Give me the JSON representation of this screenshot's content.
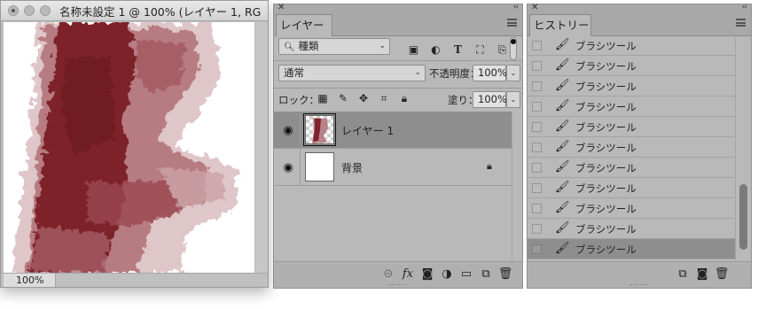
{
  "document": {
    "title": "名称未設定 1 @ 100% (レイヤー 1, RG...",
    "zoom": "100%"
  },
  "layers_panel": {
    "tab": "レイヤー",
    "filter_kind": "種類",
    "blend_mode": "通常",
    "opacity_label": "不透明度：",
    "opacity_value": "100%",
    "lock_label": "ロック：",
    "fill_label": "塗り：",
    "fill_value": "100%",
    "layers": [
      {
        "name": "レイヤー 1",
        "selected": true
      },
      {
        "name": "背景",
        "locked": true
      }
    ],
    "footer_icons": [
      "link-icon",
      "fx-icon",
      "mask-icon",
      "adjustment-icon",
      "folder-icon",
      "new-layer-icon",
      "trash-icon"
    ]
  },
  "history_panel": {
    "tab": "ヒストリー",
    "items": [
      "ブラシツール",
      "ブラシツール",
      "ブラシツール",
      "ブラシツール",
      "ブラシツール",
      "ブラシツール",
      "ブラシツール",
      "ブラシツール",
      "ブラシツール",
      "ブラシツール",
      "ブラシツール"
    ],
    "active_index": 10,
    "footer_icons": [
      "new-document-from-state-icon",
      "snapshot-icon",
      "trash-icon"
    ]
  },
  "colors": {
    "paint_dark": "#7a1f27",
    "paint_mid": "#9e4f55",
    "paint_light": "#d9b8bb",
    "panel_bg": "#b9b9b9",
    "selected_row": "#8e8e8e"
  }
}
